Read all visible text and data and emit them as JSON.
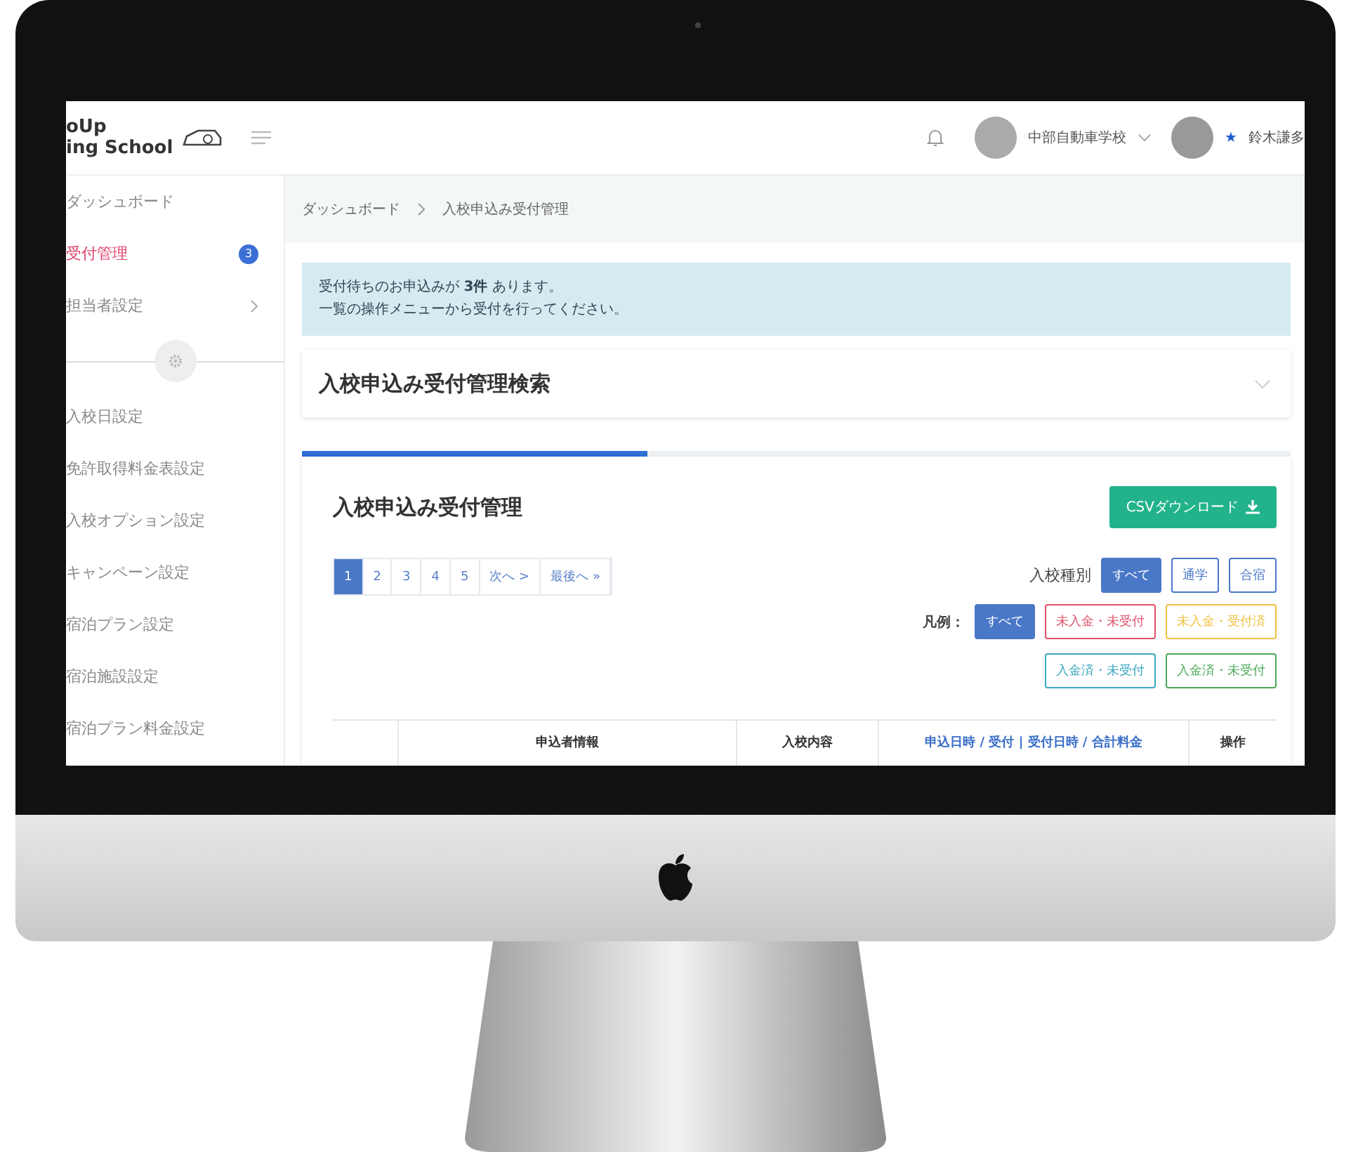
{
  "logo": {
    "line1": "oUp",
    "line2": "ing School"
  },
  "header": {
    "school": "中部自動車学校",
    "user_mark": "★",
    "user": "鈴木謙多"
  },
  "sidebar": {
    "items": [
      {
        "label": "ダッシュボード",
        "selected": false,
        "kind": "plain"
      },
      {
        "label": "受付管理",
        "selected": true,
        "kind": "badge",
        "badge": "3"
      },
      {
        "label": "担当者設定",
        "selected": false,
        "kind": "chevron"
      },
      {
        "kind": "divider"
      },
      {
        "label": "入校日設定",
        "selected": false,
        "kind": "plain"
      },
      {
        "label": "免許取得料金表設定",
        "selected": false,
        "kind": "plain"
      },
      {
        "label": "入校オプション設定",
        "selected": false,
        "kind": "plain"
      },
      {
        "label": "キャンペーン設定",
        "selected": false,
        "kind": "plain"
      },
      {
        "label": "宿泊プラン設定",
        "selected": false,
        "kind": "plain"
      },
      {
        "label": "宿泊施設設定",
        "selected": false,
        "kind": "plain"
      },
      {
        "label": "宿泊プラン料金設定",
        "selected": false,
        "kind": "plain"
      }
    ]
  },
  "breadcrumb": [
    "ダッシュボード",
    "入校申込み受付管理"
  ],
  "alert": {
    "line1": "受付待ちのお申込みが **3件** あります。",
    "line2": "一覧の操作メニューから受付を行ってください。"
  },
  "search_panel": {
    "title": "入校申込み受付管理検索",
    "expanded": false
  },
  "progress": {
    "level": 0.35
  },
  "list_panel": {
    "title": "入校申込み受付管理",
    "csv_button": "CSVダウンロード"
  },
  "pagination": [
    {
      "label": "1",
      "selected": true
    },
    {
      "label": "2",
      "selected": false
    },
    {
      "label": "3",
      "selected": false
    },
    {
      "label": "4",
      "selected": false
    },
    {
      "label": "5",
      "selected": false
    },
    {
      "label": "次へ >",
      "selected": false
    },
    {
      "label": "最後へ »",
      "selected": false
    }
  ],
  "type_filter": {
    "label": "入校種別",
    "options": [
      {
        "label": "すべて",
        "selected": true
      },
      {
        "label": "通学",
        "selected": false
      },
      {
        "label": "合宿",
        "selected": false
      }
    ]
  },
  "legend": {
    "label": "凡例：",
    "items": [
      {
        "label": "すべて",
        "selected": true,
        "color": "#4a78c8"
      },
      {
        "label": "未入金・未受付",
        "selected": false,
        "color": "#e0506a"
      },
      {
        "label": "未入金・受付済",
        "selected": false,
        "color": "#f0c040"
      },
      {
        "label": "入金済・未受付",
        "selected": false,
        "color": "#3aa8c0"
      },
      {
        "label": "入金済・未受付",
        "selected": false,
        "color": "#4aaa5a"
      }
    ]
  },
  "table": {
    "columns": [
      "",
      "申込者情報",
      "入校内容",
      "申込日時 / 受付 | 受付日時 / 合計料金",
      "操作"
    ]
  }
}
